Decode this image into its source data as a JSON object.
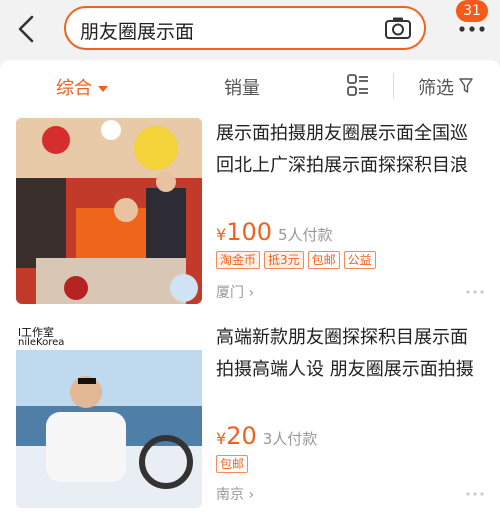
{
  "header": {
    "search_query": "朋友圈展示面",
    "notification_count": "31"
  },
  "sort_bar": {
    "items": [
      "综合",
      "销量",
      "筛选"
    ]
  },
  "products": [
    {
      "title": "展示面拍摄朋友圈展示面全国巡回北上广深拍展示面探探积目浪",
      "currency": "¥",
      "price": "100",
      "paid": "5人付款",
      "tags": [
        "淘金币",
        "抵3元",
        "包邮",
        "公益"
      ],
      "location": "厦门"
    },
    {
      "title": "高端新款朋友圈探探积目展示面拍摄高端人设 朋友圈展示面拍摄",
      "currency": "¥",
      "price": "20",
      "paid": "3人付款",
      "tags": [
        "包邮"
      ],
      "location": "南京",
      "image_caption_1": "l工作室",
      "image_caption_2": "nileKorea"
    }
  ]
}
